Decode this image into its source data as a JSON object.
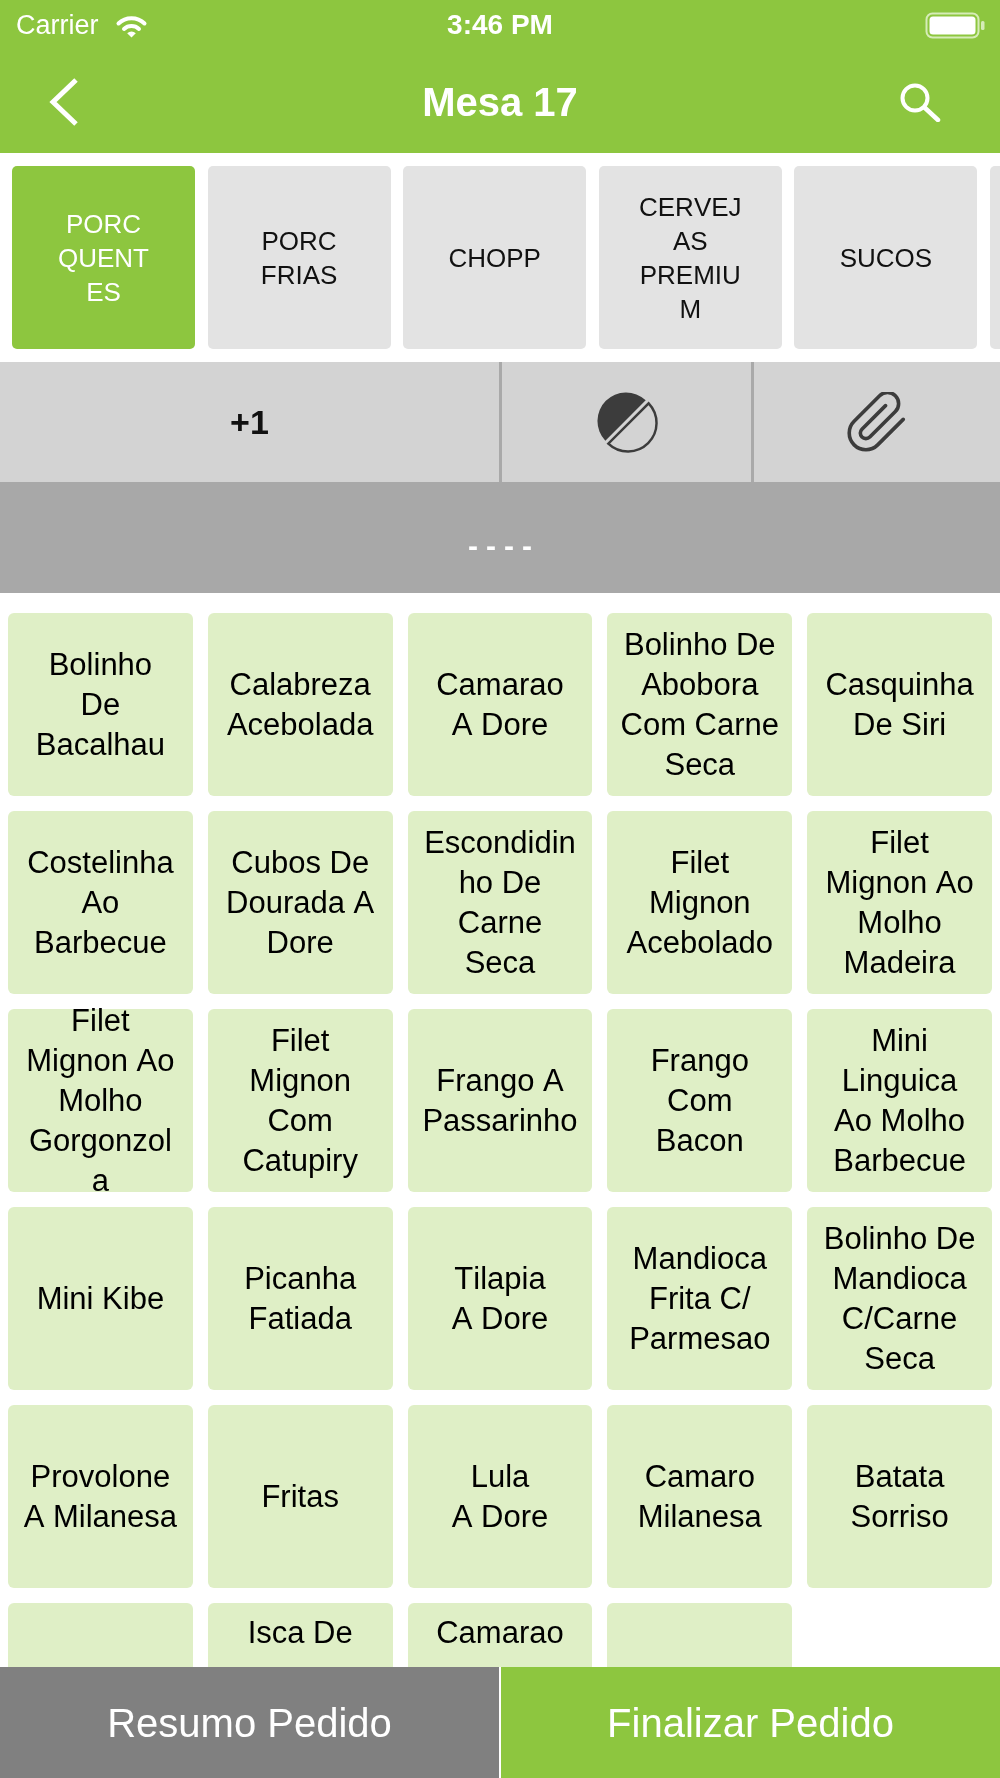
{
  "status_bar": {
    "carrier": "Carrier",
    "time": "3:46 PM"
  },
  "nav_bar": {
    "title": "Mesa 17"
  },
  "categories": [
    {
      "label": "PORC QUENTES",
      "selected": true
    },
    {
      "label": "PORC FRIAS",
      "selected": false
    },
    {
      "label": "CHOPP",
      "selected": false
    },
    {
      "label": "CERVEJAS PREMIUM",
      "selected": false
    },
    {
      "label": "SUCOS",
      "selected": false
    },
    {
      "selected": false
    }
  ],
  "toolbar": {
    "quantity_button": "+1"
  },
  "note_bar": {
    "text": "----"
  },
  "products": [
    {
      "kind": "full",
      "name": "Bolinho\nDe\nBacalhau"
    },
    {
      "kind": "full",
      "name": "Calabreza Acebolada"
    },
    {
      "kind": "full",
      "name": "Camarao\nA Dore"
    },
    {
      "kind": "full",
      "name": "Bolinho De Abobora Com Carne Seca"
    },
    {
      "kind": "full",
      "name": "Casquinha De Siri"
    },
    {
      "kind": "full",
      "name": "Costelinha Ao Barbecue"
    },
    {
      "kind": "full",
      "name": "Cubos De Dourada A Dore"
    },
    {
      "kind": "full",
      "name": "Escondidinho De Carne Seca"
    },
    {
      "kind": "full",
      "name": "Filet Mignon Acebolado"
    },
    {
      "kind": "full",
      "name": "Filet Mignon Ao Molho Madeira"
    },
    {
      "kind": "full",
      "name": "Filet Mignon Ao Molho Gorgonzola"
    },
    {
      "kind": "full",
      "name": "Filet Mignon Com Catupiry"
    },
    {
      "kind": "full",
      "name": "Frango A Passarinho"
    },
    {
      "kind": "full",
      "name": "Frango Com Bacon"
    },
    {
      "kind": "full",
      "name": "Mini Linguica Ao Molho Barbecue"
    },
    {
      "kind": "full",
      "name": "Mini Kibe"
    },
    {
      "kind": "full",
      "name": "Picanha Fatiada"
    },
    {
      "kind": "full",
      "name": "Tilapia\nA Dore"
    },
    {
      "kind": "full",
      "name": "Mandioca Frita C/ Parmesao"
    },
    {
      "kind": "full",
      "name": "Bolinho De Mandioca C/Carne Seca"
    },
    {
      "kind": "full",
      "name": "Provolone A Milanesa"
    },
    {
      "kind": "full",
      "name": "Fritas"
    },
    {
      "kind": "full",
      "name": "Lula\nA Dore"
    },
    {
      "kind": "full",
      "name": "Camaro Milanesa"
    },
    {
      "kind": "full",
      "name": "Batata Sorriso"
    },
    {
      "kind": "cut_off"
    },
    {
      "kind": "cut_off",
      "name": "Isca De"
    },
    {
      "kind": "cut_off",
      "name": "Camarao"
    },
    {
      "kind": "cut_off"
    }
  ],
  "bottom_bar": [
    {
      "kind": "secondary",
      "label": "Resumo Pedido"
    },
    {
      "kind": "primary",
      "label": "Finalizar Pedido"
    }
  ]
}
